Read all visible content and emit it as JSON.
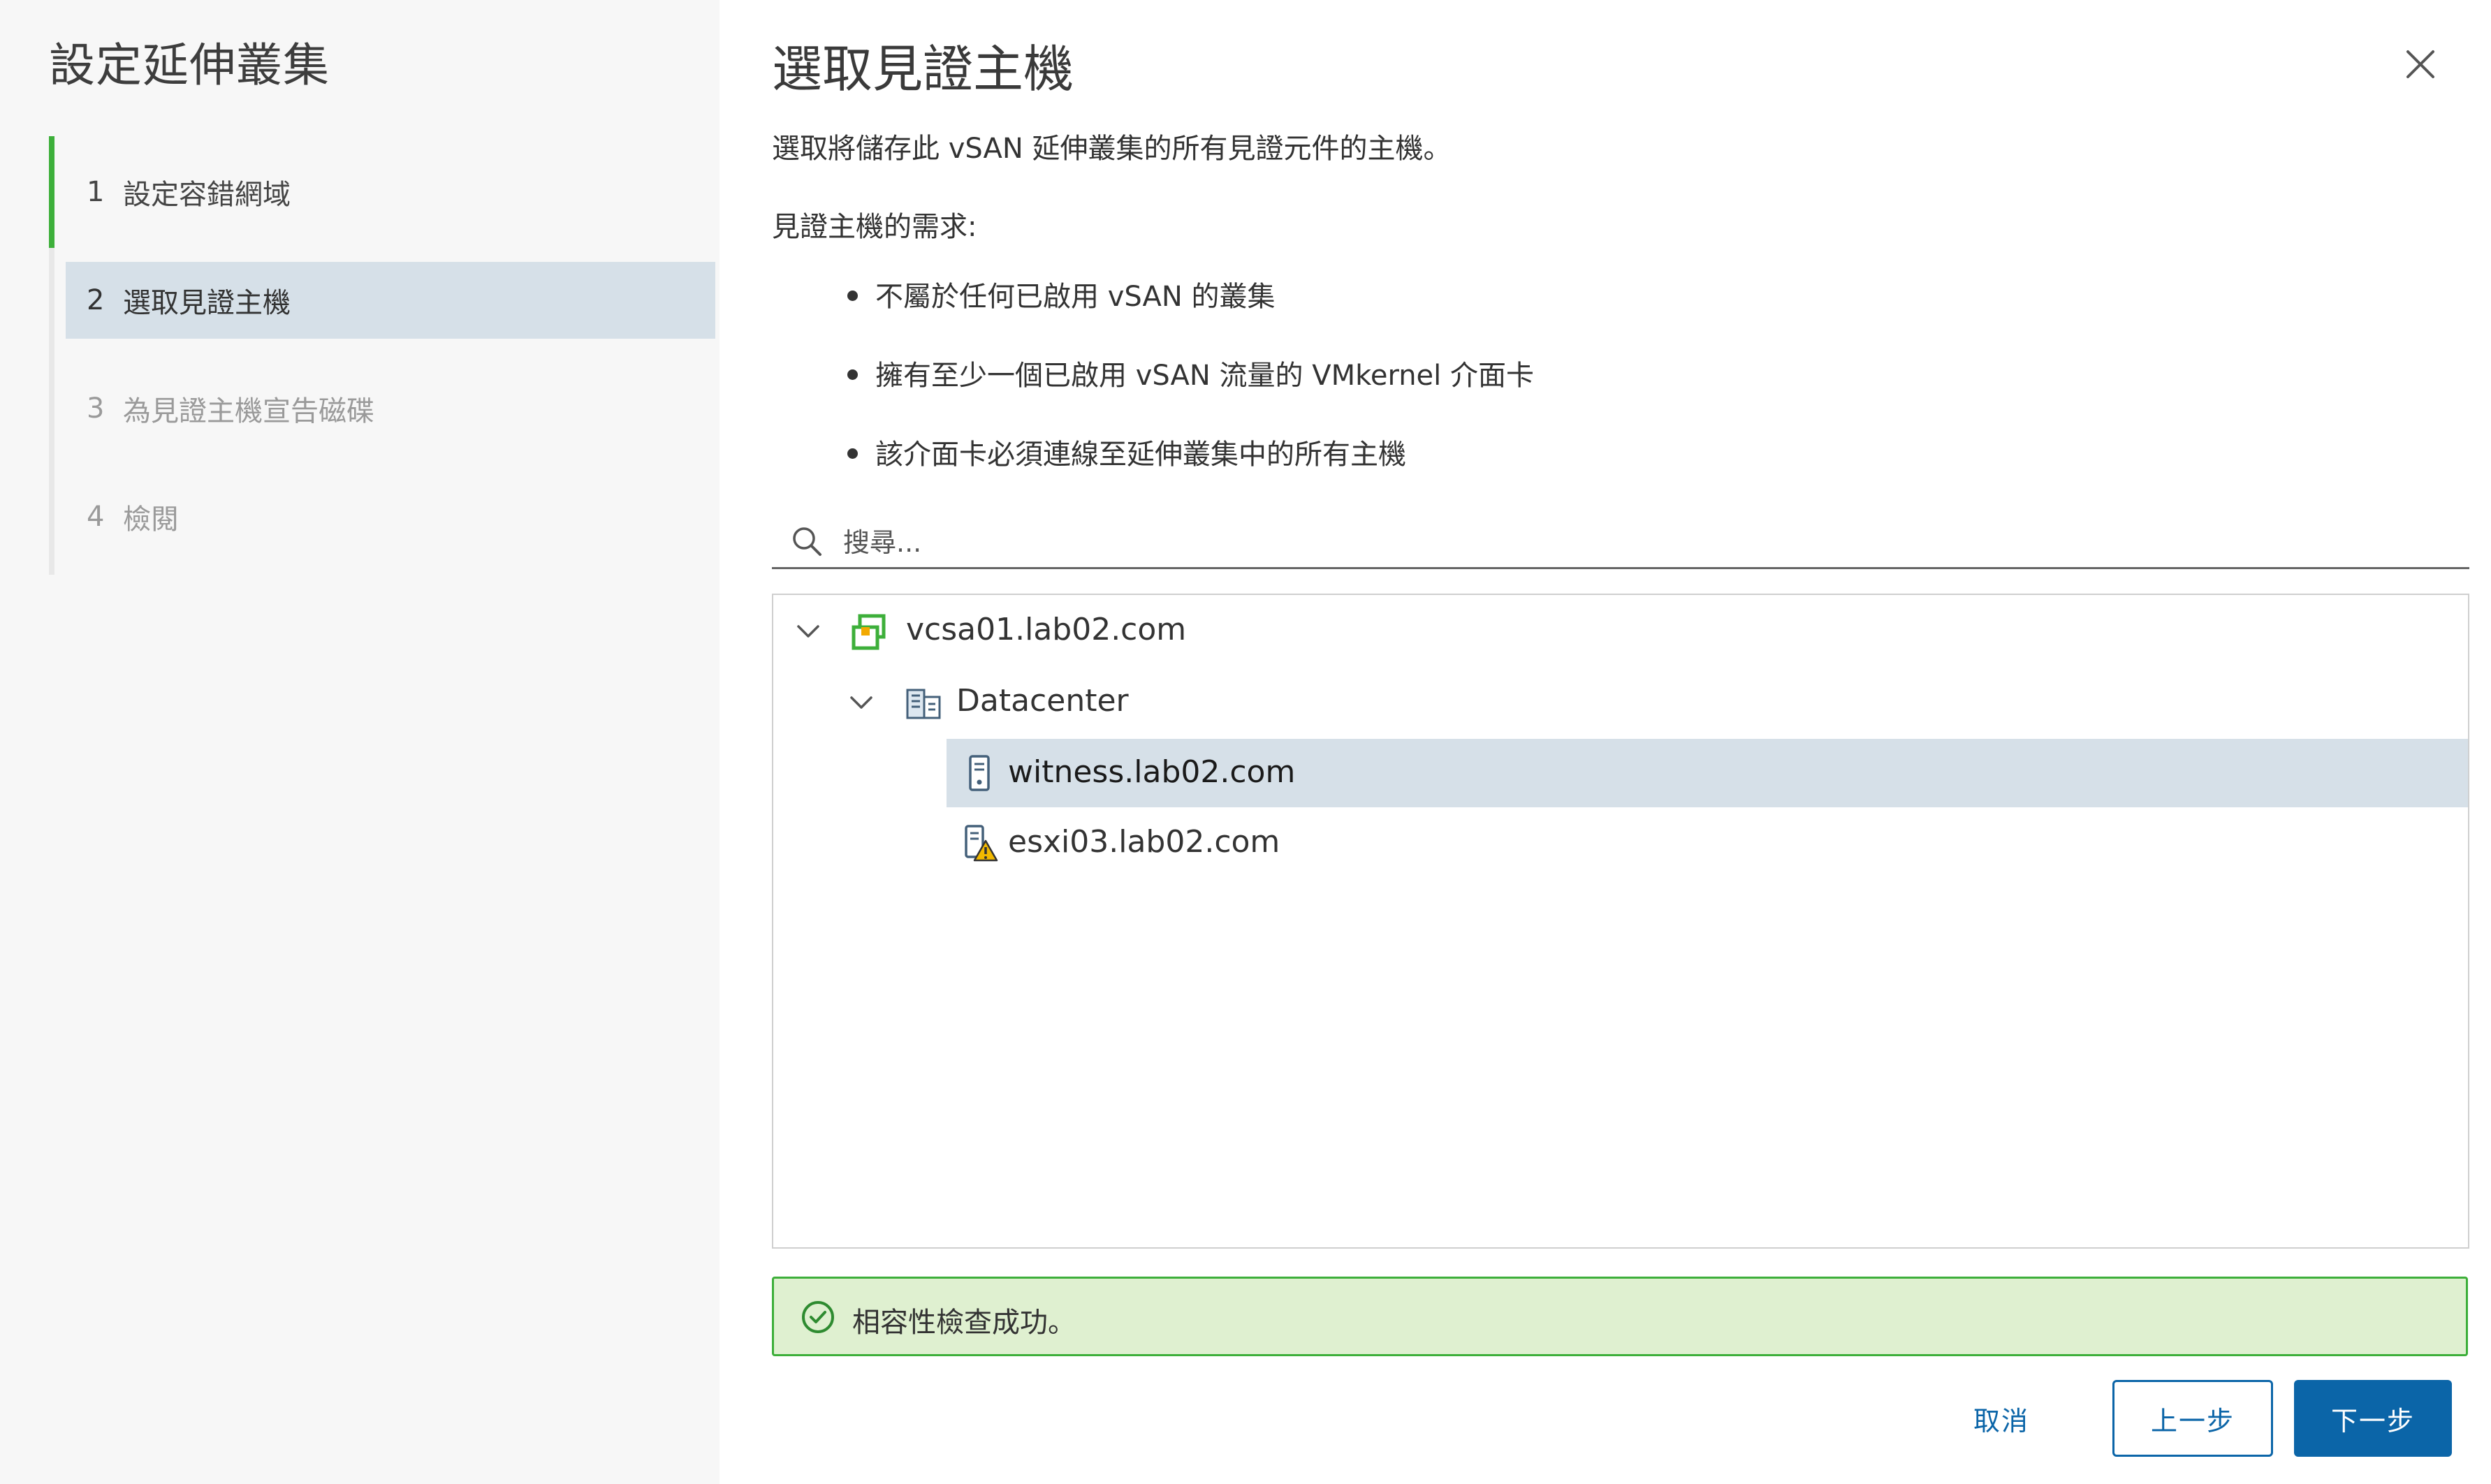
{
  "wizard": {
    "title": "設定延伸叢集",
    "steps": [
      {
        "number": "1",
        "label": "設定容錯網域",
        "state": "completed"
      },
      {
        "number": "2",
        "label": "選取見證主機",
        "state": "current"
      },
      {
        "number": "3",
        "label": "為見證主機宣告磁碟",
        "state": "pending"
      },
      {
        "number": "4",
        "label": "檢閱",
        "state": "pending"
      }
    ]
  },
  "page": {
    "title": "選取見證主機",
    "description": "選取將儲存此 vSAN 延伸叢集的所有見證元件的主機。",
    "requirements_title": "見證主機的需求:",
    "requirements": [
      "不屬於任何已啟用 vSAN 的叢集",
      "擁有至少一個已啟用 vSAN 流量的 VMkernel 介面卡",
      "該介面卡必須連線至延伸叢集中的所有主機"
    ]
  },
  "search": {
    "placeholder": "搜尋...",
    "value": ""
  },
  "tree": {
    "vcenter": {
      "label": "vcsa01.lab02.com",
      "icon": "vcenter-icon",
      "expanded": true
    },
    "datacenter": {
      "label": "Datacenter",
      "icon": "datacenter-icon",
      "expanded": true
    },
    "hosts": [
      {
        "label": "witness.lab02.com",
        "icon": "host-icon",
        "selected": true
      },
      {
        "label": "esxi03.lab02.com",
        "icon": "host-warning-icon",
        "selected": false
      }
    ]
  },
  "status": {
    "message": "相容性檢查成功。",
    "icon": "check-circle-icon"
  },
  "footer": {
    "cancel_label": "取消",
    "back_label": "上一步",
    "next_label": "下一步"
  },
  "colors": {
    "accent": "#0b65a8",
    "success": "#3daf3a",
    "selected_row": "#d6e0e8",
    "sidebar_bg": "#f7f7f7"
  }
}
